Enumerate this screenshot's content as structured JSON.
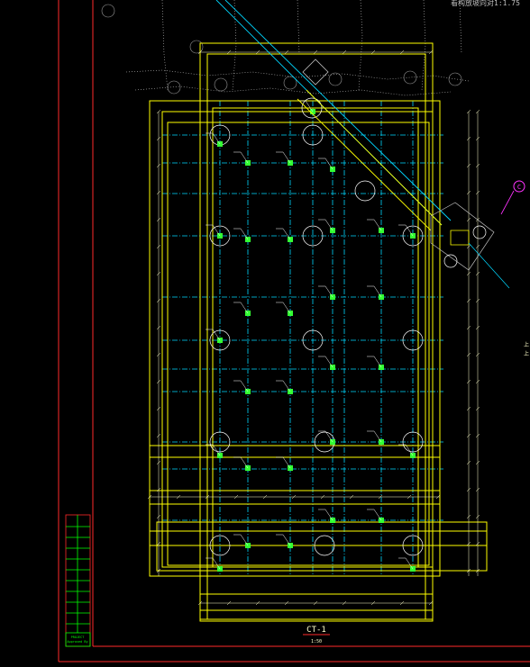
{
  "drawing": {
    "top_right_note": "看构放坡向对1:1.75",
    "detail_title": "CT-1",
    "detail_scale": "1:50",
    "side_marker_top": "上",
    "side_marker_bottom": "上",
    "grid_bubble": "C",
    "titleblock_label_1": "PROJECT",
    "titleblock_label_2": "Approved By"
  },
  "colors": {
    "background": "#000000",
    "frame": "#ff2a2a",
    "outline": "#ffff00",
    "dim": "#ffffcc",
    "grid_axis": "#00d7ff",
    "pile": "#ffffff",
    "rebar_tag": "#33ff33",
    "survey": "#bfbfbf",
    "grid_bubble": "#ff33ff",
    "titleblock": "#00ff00"
  }
}
